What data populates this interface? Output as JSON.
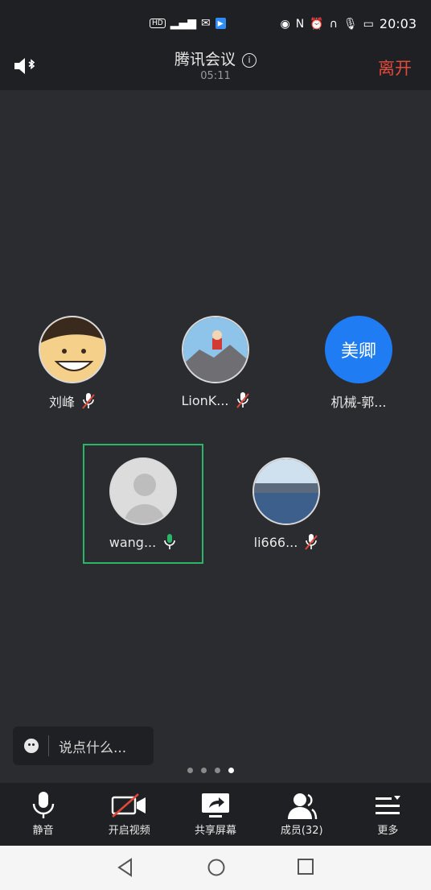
{
  "status_bar": {
    "time": "20:03",
    "hd": "HD",
    "signal": "4G"
  },
  "header": {
    "title": "腾讯会议",
    "timer": "05:11",
    "leave": "离开"
  },
  "participants": [
    {
      "name": "刘峰",
      "avatar": "cartoon",
      "mic": "muted"
    },
    {
      "name": "LionK...",
      "avatar": "cartoon-landscape",
      "mic": "muted"
    },
    {
      "name": "机械-郭...",
      "avatar_text": "美卿",
      "mic": "none"
    },
    {
      "name": "wang...",
      "avatar": "default-person",
      "mic": "active"
    },
    {
      "name": "li666...",
      "avatar": "lake",
      "mic": "muted"
    }
  ],
  "chat": {
    "placeholder": "说点什么..."
  },
  "page_dots": {
    "count": 4,
    "active_index": 3
  },
  "toolbar": [
    {
      "label": "静音",
      "icon": "microphone-icon"
    },
    {
      "label": "开启视频",
      "icon": "video-off-icon"
    },
    {
      "label": "共享屏幕",
      "icon": "share-screen-icon"
    },
    {
      "label": "成员(32)",
      "icon": "members-icon"
    },
    {
      "label": "更多",
      "icon": "more-menu-icon"
    }
  ],
  "colors": {
    "accent_green": "#2bb567",
    "leave_red": "#e24a3c",
    "avatar_blue": "#1f7cf2",
    "mute_red": "#e2483a"
  }
}
